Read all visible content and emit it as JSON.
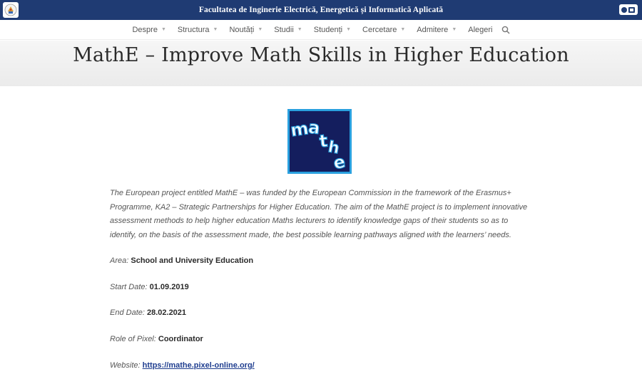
{
  "header": {
    "faculty_name": "Facultatea de Inginerie Electrică, Energetică și Informatică Aplicată",
    "left_logo_icon": "university-crest-icon",
    "right_logo_icon": "tuiasi-logo-icon"
  },
  "nav": {
    "items": [
      {
        "label": "Despre",
        "dropdown": true
      },
      {
        "label": "Structura",
        "dropdown": true
      },
      {
        "label": "Noutăți",
        "dropdown": true
      },
      {
        "label": "Studii",
        "dropdown": true
      },
      {
        "label": "Studenți",
        "dropdown": true
      },
      {
        "label": "Cercetare",
        "dropdown": true
      },
      {
        "label": "Admitere",
        "dropdown": true
      },
      {
        "label": "Alegeri",
        "dropdown": false
      }
    ],
    "search_icon": "search-icon"
  },
  "page": {
    "title": "MathE – Improve Math Skills in Higher Education",
    "logo": {
      "letters": [
        "m",
        "a",
        "t",
        "h",
        "e"
      ],
      "bg_color": "#141e5e",
      "border_color": "#2aa0df"
    },
    "intro": "The European project entitled MathE – was funded by the European Commission in the framework of the Erasmus+ Programme, KA2 – Strategic Partnerships for Higher Education. The aim of the MathE project is to implement innovative assessment methods to help higher education Maths lecturers to identify knowledge gaps of their students so as to identify, on the basis of the assessment made, the best possible learning pathways aligned with the learners’ needs.",
    "area_label": "Area:",
    "area_value": "School and University Education",
    "start_label": "Start Date:",
    "start_value": "01.09.2019",
    "end_label": "End Date:",
    "end_value": "28.02.2021",
    "role_label": "Role of Pixel:",
    "role_value": "Coordinator",
    "website_label": "Website:",
    "website_value": "https://mathe.pixel-online.org/"
  },
  "colors": {
    "topbar": "#1f3b73",
    "link": "#1e3d8f"
  }
}
